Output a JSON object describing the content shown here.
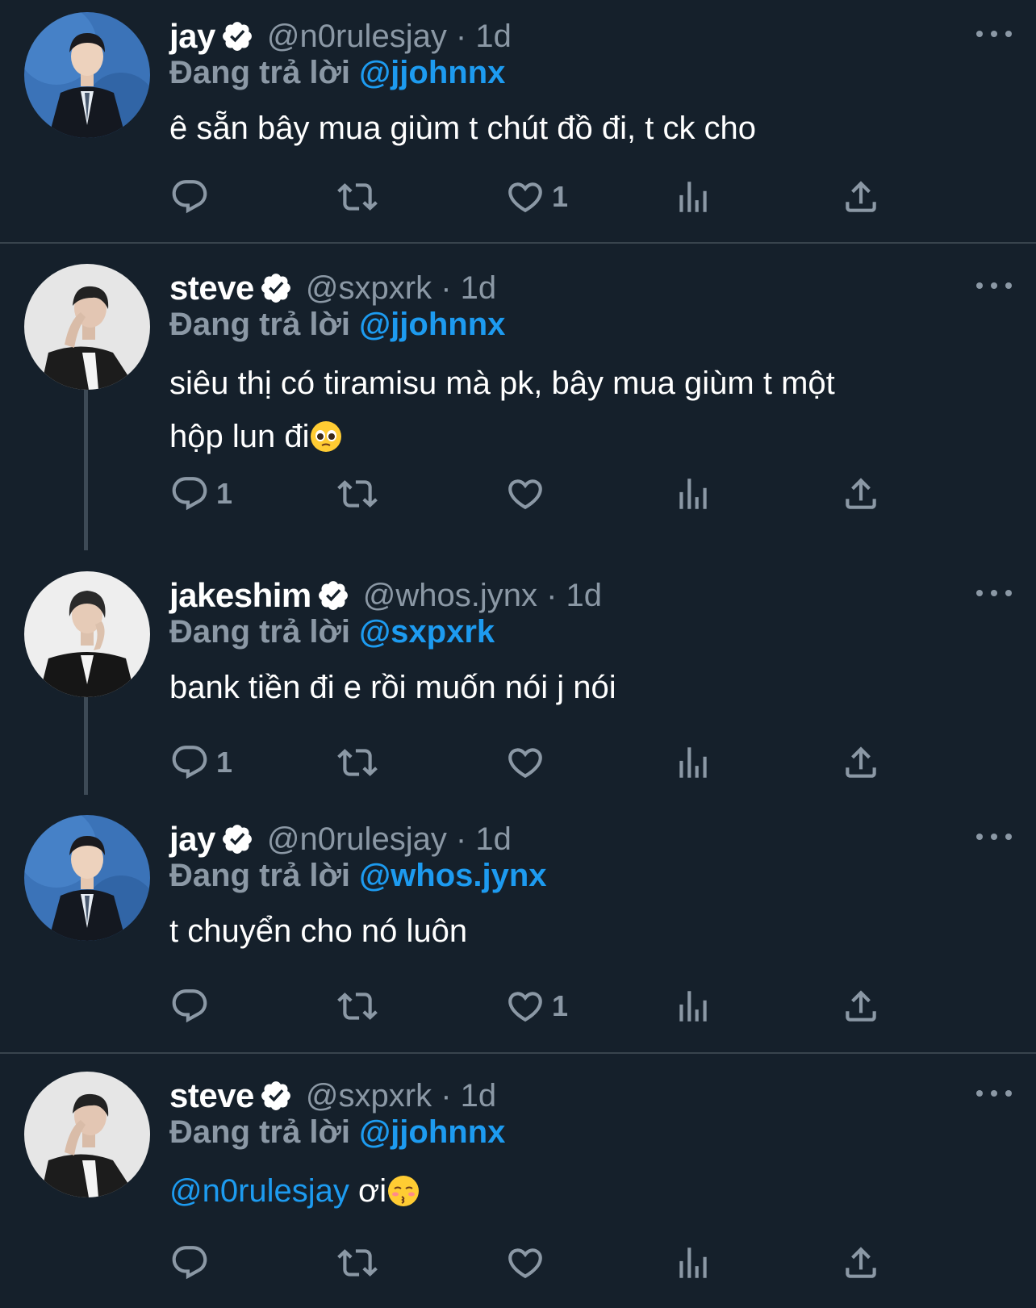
{
  "colors": {
    "background": "#15202b",
    "text": "#ffffff",
    "secondary": "#8b98a5",
    "accent": "#1d9bf0",
    "divider": "#38444d"
  },
  "icons": [
    "reply-icon",
    "retweet-icon",
    "like-icon",
    "views-icon",
    "share-icon",
    "verified-badge-icon",
    "more-icon"
  ],
  "tweets": [
    {
      "name": "jay",
      "handle": "@n0rulesjay · 1d",
      "reply_prefix": "Đang trả lời",
      "reply_to": "@jjohnnx",
      "text": "ê sẵn bây mua giùm t chút đồ đi, t ck cho",
      "reply_count": "",
      "like_count": "1"
    },
    {
      "name": "steve",
      "handle": "@sxpxrk · 1d",
      "reply_prefix": "Đang trả lời",
      "reply_to": "@jjohnnx",
      "text_line1": "siêu thị có tiramisu mà pk, bây mua giùm t một",
      "text_line2": "hộp lun đi",
      "emoji": "pleading-face-emoji",
      "reply_count": "1",
      "like_count": ""
    },
    {
      "name": "jakeshim",
      "handle": "@whos.jynx · 1d",
      "reply_prefix": "Đang trả lời",
      "reply_to": "@sxpxrk",
      "text": "bank tiền đi e rồi muốn nói j nói",
      "reply_count": "1",
      "like_count": ""
    },
    {
      "name": "jay",
      "handle": "@n0rulesjay · 1d",
      "reply_prefix": "Đang trả lời",
      "reply_to": "@whos.jynx",
      "text": "t chuyển cho nó luôn",
      "reply_count": "",
      "like_count": "1"
    },
    {
      "name": "steve",
      "handle": "@sxpxrk · 1d",
      "reply_prefix": "Đang trả lời",
      "reply_to": "@jjohnnx",
      "text_mention": "@n0rulesjay",
      "text_rest": " ơi",
      "emoji": "kissing-face-emoji",
      "reply_count": "",
      "like_count": ""
    }
  ]
}
